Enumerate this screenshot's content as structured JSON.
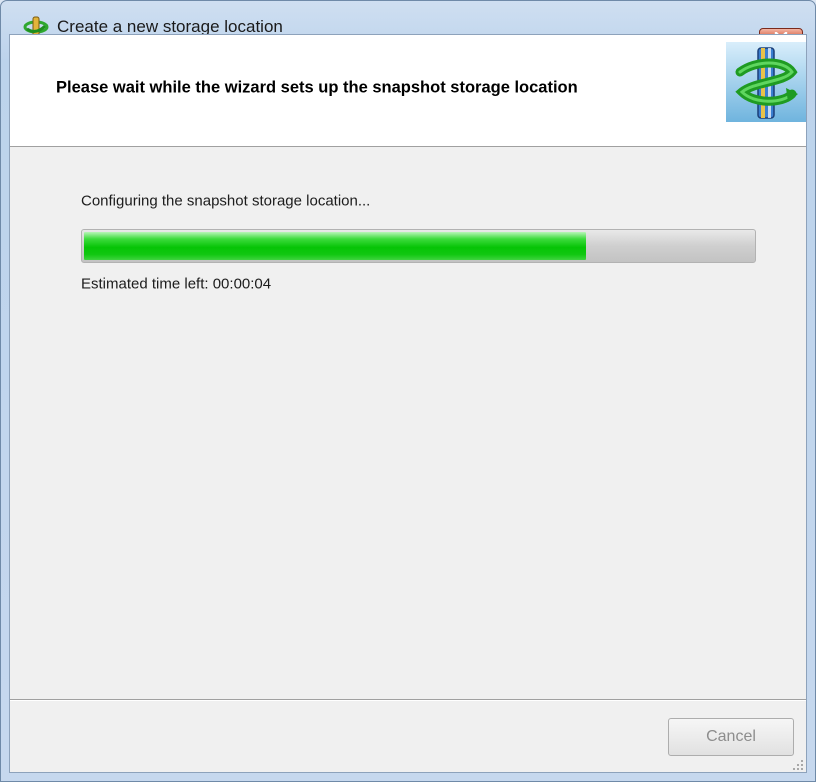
{
  "window": {
    "title": "Create a new storage location",
    "close_icon": "close-icon"
  },
  "header": {
    "text": "Please wait while the wizard sets up the snapshot storage location",
    "graphic": "wizard-snapshot-logo"
  },
  "content": {
    "status": "Configuring the snapshot storage location...",
    "progress_fraction": 0.75,
    "time_left": "Estimated time left: 00:00:04"
  },
  "footer": {
    "cancel_label": "Cancel"
  },
  "colors": {
    "progress_green": "#06c406",
    "header_bg": "#ffffff",
    "client_bg": "#f0f0f0",
    "close_red": "#c3402a"
  }
}
